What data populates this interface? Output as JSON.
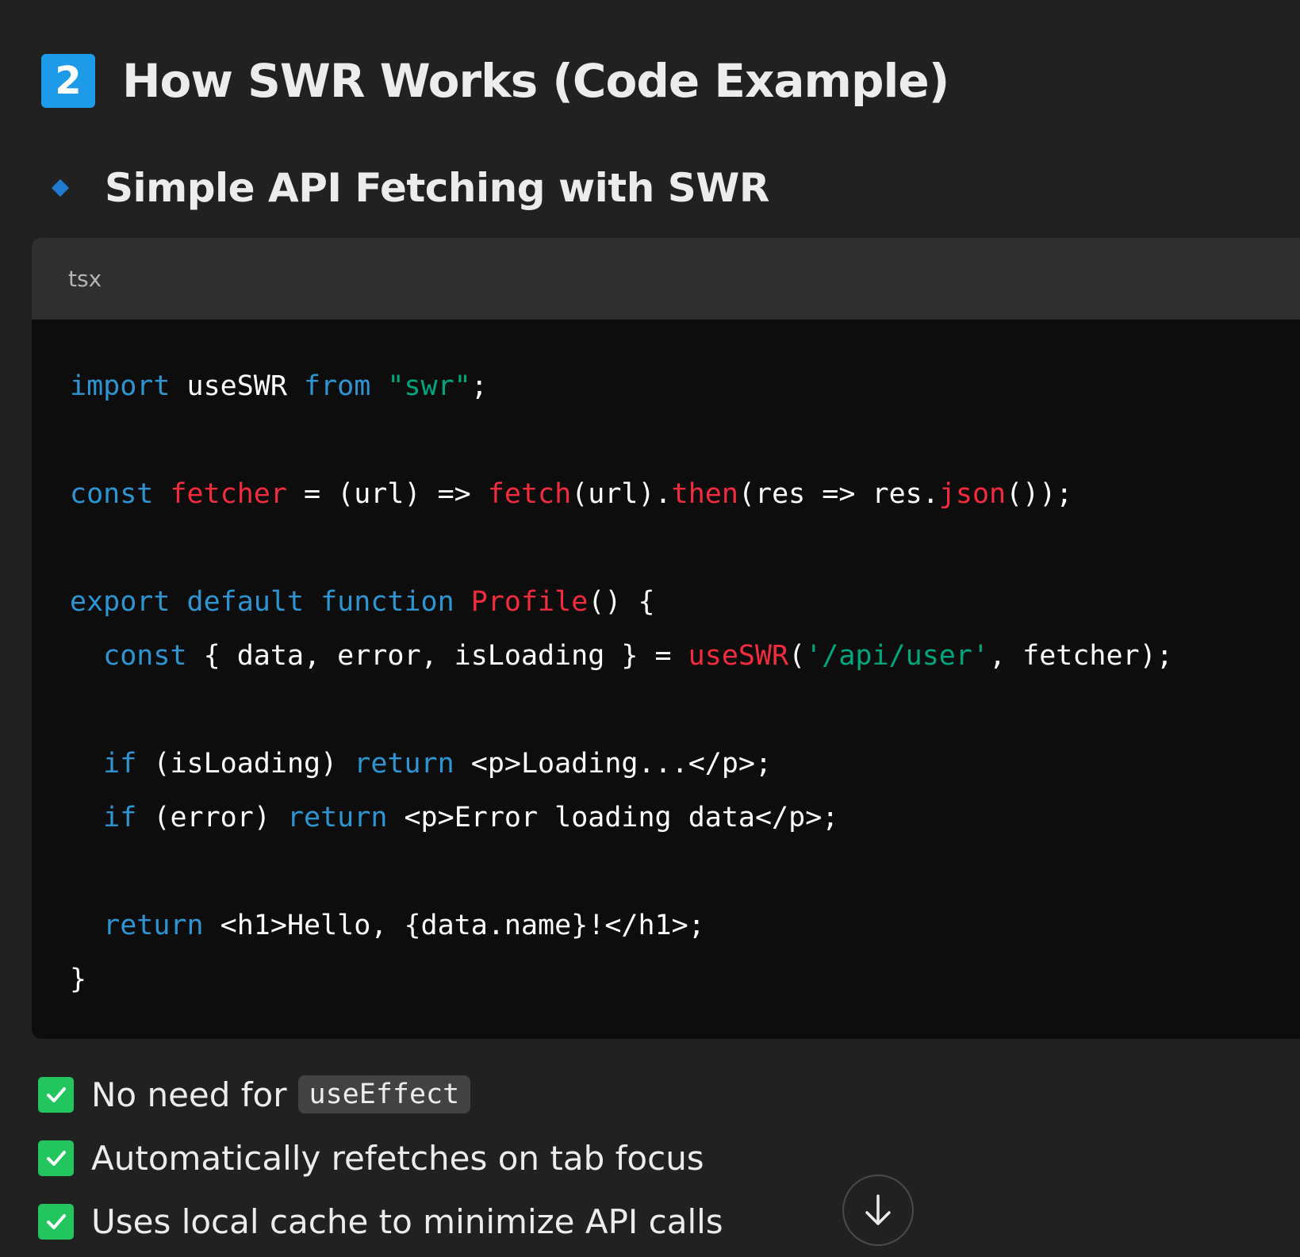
{
  "heading": {
    "number": "2",
    "title": "How SWR Works (Code Example)"
  },
  "subheading": {
    "title": "Simple API Fetching with SWR"
  },
  "code_block": {
    "language": "tsx",
    "lines": [
      [
        {
          "t": "kw",
          "v": "import"
        },
        {
          "t": "pl",
          "v": " useSWR "
        },
        {
          "t": "kw",
          "v": "from"
        },
        {
          "t": "pl",
          "v": " "
        },
        {
          "t": "str",
          "v": "\"swr\""
        },
        {
          "t": "pl",
          "v": ";"
        }
      ],
      [],
      [
        {
          "t": "kw",
          "v": "const"
        },
        {
          "t": "pl",
          "v": " "
        },
        {
          "t": "fn",
          "v": "fetcher"
        },
        {
          "t": "pl",
          "v": " = (url) => "
        },
        {
          "t": "fn",
          "v": "fetch"
        },
        {
          "t": "pl",
          "v": "(url)."
        },
        {
          "t": "fn",
          "v": "then"
        },
        {
          "t": "pl",
          "v": "(res => res."
        },
        {
          "t": "fn",
          "v": "json"
        },
        {
          "t": "pl",
          "v": "());"
        }
      ],
      [],
      [
        {
          "t": "kw",
          "v": "export"
        },
        {
          "t": "pl",
          "v": " "
        },
        {
          "t": "kw",
          "v": "default"
        },
        {
          "t": "pl",
          "v": " "
        },
        {
          "t": "kw",
          "v": "function"
        },
        {
          "t": "pl",
          "v": " "
        },
        {
          "t": "fn",
          "v": "Profile"
        },
        {
          "t": "pl",
          "v": "() {"
        }
      ],
      [
        {
          "t": "pl",
          "v": "  "
        },
        {
          "t": "kw",
          "v": "const"
        },
        {
          "t": "pl",
          "v": " { data, error, isLoading } = "
        },
        {
          "t": "fn",
          "v": "useSWR"
        },
        {
          "t": "pl",
          "v": "("
        },
        {
          "t": "str",
          "v": "'/api/user'"
        },
        {
          "t": "pl",
          "v": ", fetcher);"
        }
      ],
      [],
      [
        {
          "t": "pl",
          "v": "  "
        },
        {
          "t": "kw",
          "v": "if"
        },
        {
          "t": "pl",
          "v": " (isLoading) "
        },
        {
          "t": "kw",
          "v": "return"
        },
        {
          "t": "pl",
          "v": " <p>Loading...</p>;"
        }
      ],
      [
        {
          "t": "pl",
          "v": "  "
        },
        {
          "t": "kw",
          "v": "if"
        },
        {
          "t": "pl",
          "v": " (error) "
        },
        {
          "t": "kw",
          "v": "return"
        },
        {
          "t": "pl",
          "v": " <p>Error loading data</p>;"
        }
      ],
      [],
      [
        {
          "t": "pl",
          "v": "  "
        },
        {
          "t": "kw",
          "v": "return"
        },
        {
          "t": "pl",
          "v": " <h1>Hello, {data.name}!</h1>;"
        }
      ],
      [
        {
          "t": "pl",
          "v": "}"
        }
      ]
    ]
  },
  "checklist": [
    {
      "text": "No need for",
      "code": "useEffect"
    },
    {
      "text": "Automatically refetches on tab focus",
      "code": ""
    },
    {
      "text": "Uses local cache to minimize API calls",
      "code": ""
    }
  ],
  "colors": {
    "badge": "#1e9be8",
    "diamond": "#1e7bd0",
    "check": "#22c55e",
    "keyword": "#2e95d3",
    "function": "#f22c3d",
    "string": "#00a67d"
  },
  "icons": {
    "badge": "number-badge-icon",
    "bullet": "diamond-bullet-icon",
    "check": "checkmark-icon",
    "scroll": "arrow-down-icon"
  }
}
